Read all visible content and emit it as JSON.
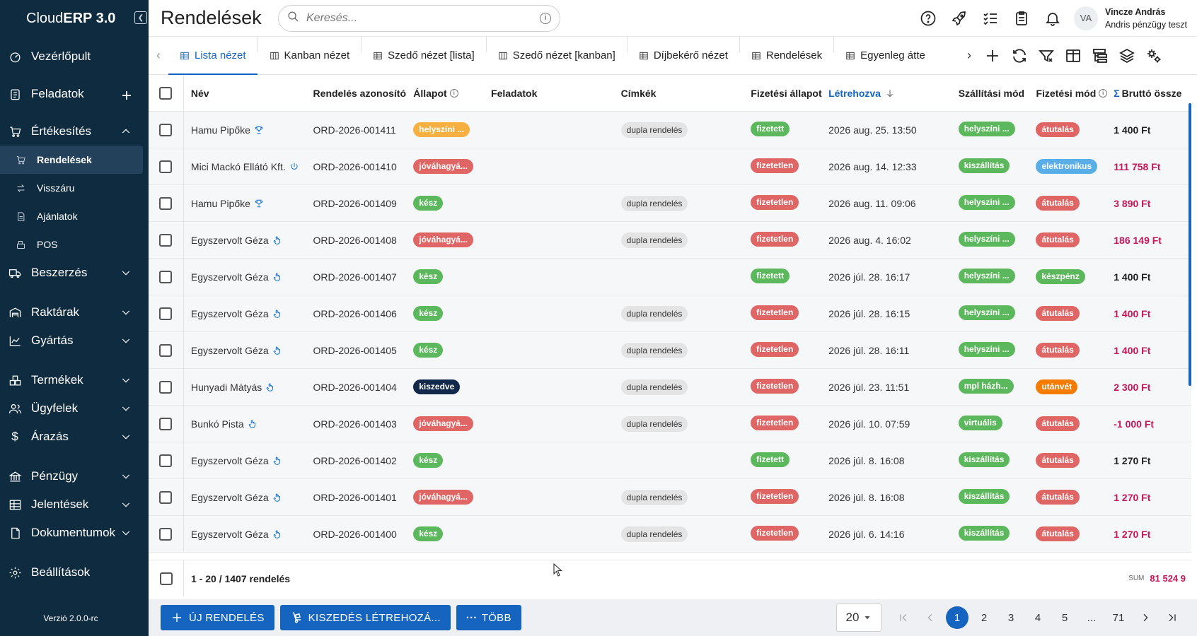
{
  "app": {
    "brand_regular": "Cloud",
    "brand_bold": "ERP 3.0",
    "version": "Verzió 2.0.0-rc"
  },
  "sidebar": {
    "items": [
      {
        "label": "Vezérlőpult",
        "icon": "dashboard-icon"
      },
      {
        "label": "Feladatok",
        "icon": "clipboard-icon"
      },
      {
        "label": "Értékesítés",
        "icon": "cart-icon"
      },
      {
        "label": "Rendelések",
        "icon": "cart-icon"
      },
      {
        "label": "Visszáru",
        "icon": "swap-icon"
      },
      {
        "label": "Ajánlatok",
        "icon": "document-icon"
      },
      {
        "label": "POS",
        "icon": "register-icon"
      },
      {
        "label": "Beszerzés",
        "icon": "truck-icon"
      },
      {
        "label": "Raktárak",
        "icon": "warehouse-icon"
      },
      {
        "label": "Gyártás",
        "icon": "chart-icon"
      },
      {
        "label": "Termékek",
        "icon": "boxes-icon"
      },
      {
        "label": "Ügyfelek",
        "icon": "people-icon"
      },
      {
        "label": "Árazás",
        "icon": "dollar-icon"
      },
      {
        "label": "Pénzügy",
        "icon": "bank-icon"
      },
      {
        "label": "Jelentések",
        "icon": "table-icon"
      },
      {
        "label": "Dokumentumok",
        "icon": "file-icon"
      },
      {
        "label": "Beállítások",
        "icon": "gear-icon"
      }
    ]
  },
  "header": {
    "title": "Rendelések",
    "search_placeholder": "Keresés...",
    "user_initials": "VA",
    "user_name": "Vincze András",
    "user_org": "Andris pénzügy teszt"
  },
  "tabs": [
    "Lista nézet",
    "Kanban nézet",
    "Szedő nézet [lista]",
    "Szedő nézet [kanban]",
    "Díjbekérő nézet",
    "Rendelések",
    "Egyenleg átte"
  ],
  "table": {
    "headers": {
      "name": "Név",
      "id": "Rendelés azonosító",
      "state": "Állapot",
      "tasks": "Feladatok",
      "tags": "Címkék",
      "pay_state": "Fizetési állapot",
      "created": "Létrehozva",
      "shipping": "Szállítási mód",
      "pay_method": "Fizetési mód",
      "gross": "Bruttó össze"
    },
    "rows": [
      {
        "name": "Hamu Pipőke",
        "id": "ORD-2026-001411",
        "state": "helyszíni ...",
        "tag": "dupla rendelés",
        "pay": "fizetett",
        "created": "2026 aug. 25. 13:50",
        "ship": "helyszíni ...",
        "method": "átutalás",
        "gross": "1 400  Ft"
      },
      {
        "name": "Mici Mackó Ellátó Kft.",
        "id": "ORD-2026-001410",
        "state": "jóváhagyá...",
        "tag": "",
        "pay": "fizetetlen",
        "created": "2026 aug. 14. 12:33",
        "ship": "kiszállítás",
        "method": "elektronikus",
        "gross": "111 758  Ft"
      },
      {
        "name": "Hamu Pipőke",
        "id": "ORD-2026-001409",
        "state": "kész",
        "tag": "dupla rendelés",
        "pay": "fizetetlen",
        "created": "2026 aug. 11. 09:06",
        "ship": "helyszíni ...",
        "method": "átutalás",
        "gross": "3 890  Ft"
      },
      {
        "name": "Egyszervolt Géza",
        "id": "ORD-2026-001408",
        "state": "jóváhagyá...",
        "tag": "dupla rendelés",
        "pay": "fizetetlen",
        "created": "2026 aug. 4. 16:02",
        "ship": "helyszíni ...",
        "method": "átutalás",
        "gross": "186 149  Ft"
      },
      {
        "name": "Egyszervolt Géza",
        "id": "ORD-2026-001407",
        "state": "kész",
        "tag": "",
        "pay": "fizetett",
        "created": "2026 júl. 28. 16:17",
        "ship": "helyszíni ...",
        "method": "készpénz",
        "gross": "1 400  Ft"
      },
      {
        "name": "Egyszervolt Géza",
        "id": "ORD-2026-001406",
        "state": "kész",
        "tag": "dupla rendelés",
        "pay": "fizetetlen",
        "created": "2026 júl. 28. 16:15",
        "ship": "helyszíni ...",
        "method": "átutalás",
        "gross": "1 400  Ft"
      },
      {
        "name": "Egyszervolt Géza",
        "id": "ORD-2026-001405",
        "state": "kész",
        "tag": "dupla rendelés",
        "pay": "fizetetlen",
        "created": "2026 júl. 28. 16:11",
        "ship": "helyszíni ...",
        "method": "átutalás",
        "gross": "1 400  Ft"
      },
      {
        "name": "Hunyadi Mátyás",
        "id": "ORD-2026-001404",
        "state": "kiszedve",
        "tag": "dupla rendelés",
        "pay": "fizetetlen",
        "created": "2026 júl. 23. 11:51",
        "ship": "mpl házh...",
        "method": "utánvét",
        "gross": "2 300  Ft"
      },
      {
        "name": "Bunkó Pista",
        "id": "ORD-2026-001403",
        "state": "jóváhagyá...",
        "tag": "dupla rendelés",
        "pay": "fizetetlen",
        "created": "2026 júl. 10. 07:59",
        "ship": "virtuális",
        "method": "átutalás",
        "gross": "-1 000  Ft"
      },
      {
        "name": "Egyszervolt Géza",
        "id": "ORD-2026-001402",
        "state": "kész",
        "tag": "",
        "pay": "fizetett",
        "created": "2026 júl. 8. 16:08",
        "ship": "kiszállítás",
        "method": "átutalás",
        "gross": "1 270  Ft"
      },
      {
        "name": "Egyszervolt Géza",
        "id": "ORD-2026-001401",
        "state": "jóváhagyá...",
        "tag": "dupla rendelés",
        "pay": "fizetetlen",
        "created": "2026 júl. 8. 16:08",
        "ship": "kiszállítás",
        "method": "átutalás",
        "gross": "1 270  Ft"
      },
      {
        "name": "Egyszervolt Géza",
        "id": "ORD-2026-001400",
        "state": "kész",
        "tag": "dupla rendelés",
        "pay": "fizetetlen",
        "created": "2026 júl. 6. 14:16",
        "ship": "kiszállítás",
        "method": "átutalás",
        "gross": "1 270  Ft"
      }
    ],
    "footer_count": "1 - 20 / 1407 rendelés",
    "sum_label": "SUM",
    "sum_value": "81 524 9"
  },
  "actions": {
    "new_order": "ÚJ RENDELÉS",
    "create_picking": "KISZEDÉS LÉTREHOZÁ...",
    "more": "TÖBB"
  },
  "pager": {
    "per_page": "20",
    "pages": [
      "1",
      "2",
      "3",
      "4",
      "5",
      "...",
      "71"
    ],
    "current": "1"
  },
  "colors": {
    "sidebar_bg": "#0f2b40",
    "accent": "#1565c0",
    "green": "#5cb85c",
    "red": "#e06666",
    "orange": "#f5b041",
    "navy": "#13294b",
    "blue_light": "#5aaee8",
    "utanvet": "#f57c00",
    "negative_amount": "#c2185b"
  }
}
